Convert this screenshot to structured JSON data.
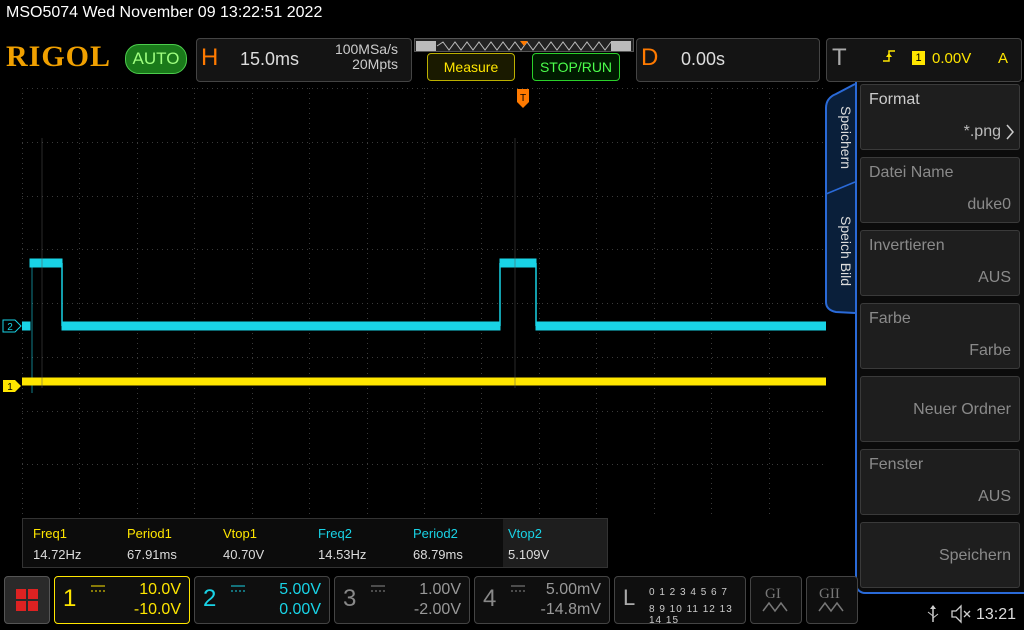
{
  "status": "MSO5074  Wed November 09 13:22:51 2022",
  "toolbar": {
    "logo": "RIGOL",
    "mode": "AUTO",
    "h_letter": "H",
    "timebase": "15.0ms",
    "sample_rate": "100MSa/s",
    "memory_depth": "20Mpts",
    "measure_label": "Measure",
    "stoprun_label": "STOP/RUN",
    "d_letter": "D",
    "delay": "0.00s",
    "t_letter": "T",
    "trigger_channel": "1",
    "trigger_level": "0.00V",
    "trigger_mode": "A"
  },
  "markers": {
    "ch2": "2",
    "ch1": "1",
    "trigger": "T"
  },
  "measurements": [
    {
      "label": "Freq1",
      "value": "14.72Hz",
      "color": "#ffe600"
    },
    {
      "label": "Period1",
      "value": "67.91ms",
      "color": "#ffe600"
    },
    {
      "label": "Vtop1",
      "value": "40.70V",
      "color": "#ffe600"
    },
    {
      "label": "Freq2",
      "value": "14.53Hz",
      "color": "#19d3e6"
    },
    {
      "label": "Period2",
      "value": "68.79ms",
      "color": "#19d3e6"
    },
    {
      "label": "Vtop2",
      "value": "5.109V",
      "color": "#19d3e6"
    }
  ],
  "menu": {
    "tab1": "Speichern",
    "tab2": "Speich Bild",
    "items": [
      {
        "title": "Format",
        "value": "*.png"
      },
      {
        "title": "Datei Name",
        "value": "duke0"
      },
      {
        "title": "Invertieren",
        "value": "AUS"
      },
      {
        "title": "Farbe",
        "value": "Farbe"
      },
      {
        "title": "",
        "value": "Neuer Ordner"
      },
      {
        "title": "Fenster",
        "value": "AUS"
      },
      {
        "title": "",
        "value": "Speichern"
      }
    ]
  },
  "channels": [
    {
      "num": "1",
      "scale": "10.0V",
      "offset": "-10.0V",
      "color": "#ffe600"
    },
    {
      "num": "2",
      "scale": "5.00V",
      "offset": "0.00V",
      "color": "#19d3e6"
    },
    {
      "num": "3",
      "scale": "1.00V",
      "offset": "-2.00V",
      "color": "#888888"
    },
    {
      "num": "4",
      "scale": "5.00mV",
      "offset": "-14.8mV",
      "color": "#888888"
    }
  ],
  "logic": {
    "letter": "L",
    "row1": "0 1 2 3  4 5 6 7",
    "row2": "8 9 10 11 12 13 14 15"
  },
  "clock": "13:21"
}
